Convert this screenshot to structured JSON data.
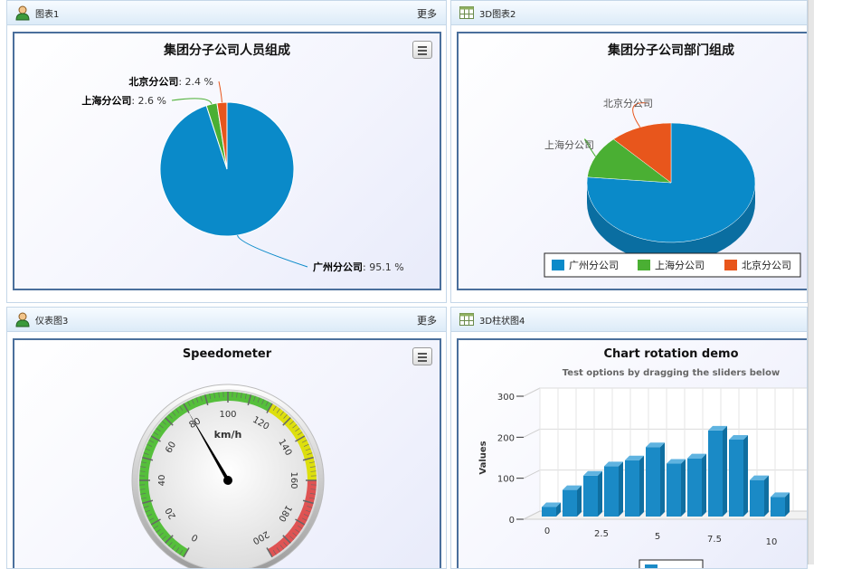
{
  "panels": {
    "p1": {
      "title": "图表1",
      "more": "更多",
      "icon": "user-icon"
    },
    "p2": {
      "title": "3D图表2",
      "icon": "table-icon"
    },
    "p3": {
      "title": "仪表图3",
      "more": "更多",
      "icon": "user-icon"
    },
    "p4": {
      "title": "3D柱状图4",
      "icon": "table-icon"
    }
  },
  "charts": {
    "pie1": {
      "title": "集团分子公司人员组成"
    },
    "pie2": {
      "title": "集团分子公司部门组成"
    },
    "gauge": {
      "title": "Speedometer",
      "unit": "km/h"
    },
    "column3d": {
      "title": "Chart rotation demo",
      "subtitle": "Test options by dragging the sliders below",
      "ylabel": "Values"
    }
  },
  "colors": {
    "blue": "#0a8ac9",
    "green": "#4aaf33",
    "orange": "#e8561c",
    "header": "#dcebf8",
    "frame": "#4a6f9c"
  },
  "chart_data": [
    {
      "type": "pie",
      "title": "集团分子公司人员组成",
      "slices": [
        {
          "name": "广州分公司",
          "value": 95.1,
          "label": "广州分公司",
          "pct": ": 95.1 %",
          "color": "#0a8ac9"
        },
        {
          "name": "上海分公司",
          "value": 2.6,
          "label": "上海分公司",
          "pct": ": 2.6 %",
          "color": "#4aaf33"
        },
        {
          "name": "北京分公司",
          "value": 2.4,
          "label": "北京分公司",
          "pct": ": 2.4 %",
          "color": "#e8561c"
        }
      ]
    },
    {
      "type": "pie",
      "title": "集团分子公司部门组成",
      "slices": [
        {
          "name": "广州分公司",
          "value": 76.5,
          "color": "#0a8ac9"
        },
        {
          "name": "上海分公司",
          "value": 11.5,
          "color": "#4aaf33"
        },
        {
          "name": "北京分公司",
          "value": 12.0,
          "color": "#e8561c"
        }
      ],
      "legend": [
        "广州分公司",
        "上海分公司",
        "北京分公司"
      ],
      "legend_position": "bottom"
    },
    {
      "type": "gauge",
      "title": "Speedometer",
      "unit": "km/h",
      "value": 80,
      "min": 0,
      "max": 200,
      "ticks": [
        0,
        20,
        40,
        60,
        80,
        100,
        120,
        140,
        160,
        180,
        200
      ],
      "bands": [
        {
          "from": 0,
          "to": 120,
          "color": "#55bf3b"
        },
        {
          "from": 120,
          "to": 160,
          "color": "#dddf0d"
        },
        {
          "from": 160,
          "to": 200,
          "color": "#df5353"
        }
      ]
    },
    {
      "type": "bar",
      "title": "Chart rotation demo",
      "subtitle": "Test options by dragging the sliders below",
      "ylabel": "Values",
      "ylim": [
        0,
        300
      ],
      "yticks": [
        0,
        100,
        200,
        300
      ],
      "xticks": [
        "0",
        "2.5",
        "5",
        "7.5",
        "10"
      ],
      "x": [
        0,
        1,
        2,
        3,
        4,
        5,
        6,
        7,
        8,
        9,
        10,
        11
      ],
      "values": [
        29.9,
        71.5,
        106.4,
        129.2,
        144.0,
        176.0,
        135.6,
        148.5,
        216.4,
        194.1,
        95.6,
        54.4
      ],
      "color": "#1a8ac6"
    }
  ]
}
